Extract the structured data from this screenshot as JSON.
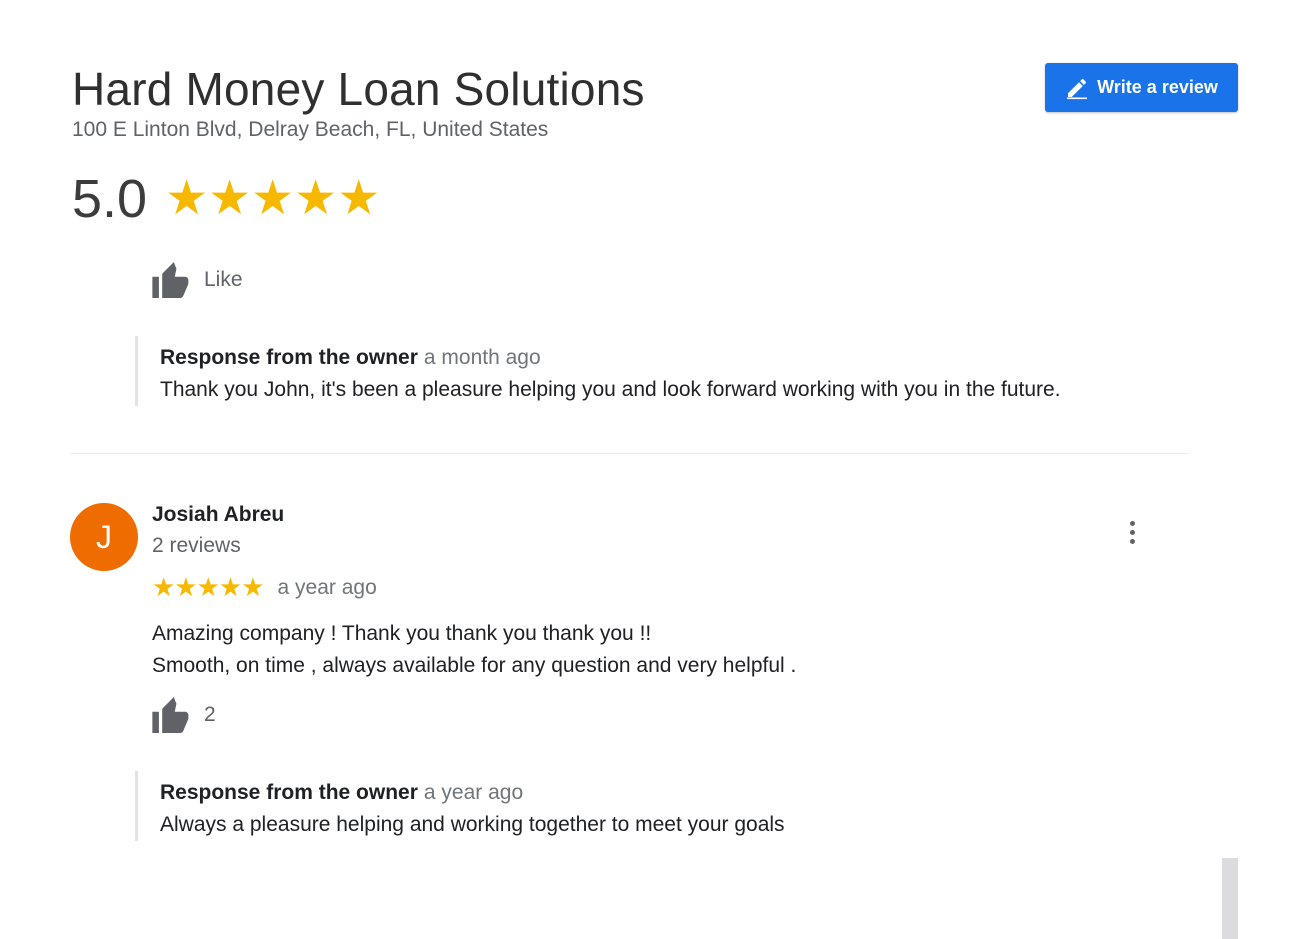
{
  "business": {
    "name": "Hard Money Loan Solutions",
    "address": "100 E Linton Blvd, Delray Beach, FL, United States",
    "rating": "5.0",
    "stars": "★★★★★",
    "write_review_label": "Write a review"
  },
  "colors": {
    "accent": "#1a73e8",
    "star": "#f6b900",
    "avatar": "#ef6c00"
  },
  "previous_review": {
    "like_label": "Like",
    "owner_response": {
      "label": "Response from the owner",
      "time": "a month ago",
      "text": "Thank you John, it's been a pleasure helping you and look forward working with you in the future."
    }
  },
  "review": {
    "avatar_initial": "J",
    "author": "Josiah Abreu",
    "review_count": "2 reviews",
    "stars": "★★★★★",
    "rating": 5,
    "time": "a year ago",
    "text_line1": "Amazing company ! Thank you thank you thank you !!",
    "text_line2": "Smooth, on time , always available for any question and very helpful .",
    "likes": "2",
    "owner_response": {
      "label": "Response from the owner",
      "time": "a year ago",
      "text": "Always a pleasure helping and working together to meet your goals"
    }
  },
  "icons": [
    "pencil-icon",
    "thumbs-up-icon",
    "more-vert-icon"
  ]
}
